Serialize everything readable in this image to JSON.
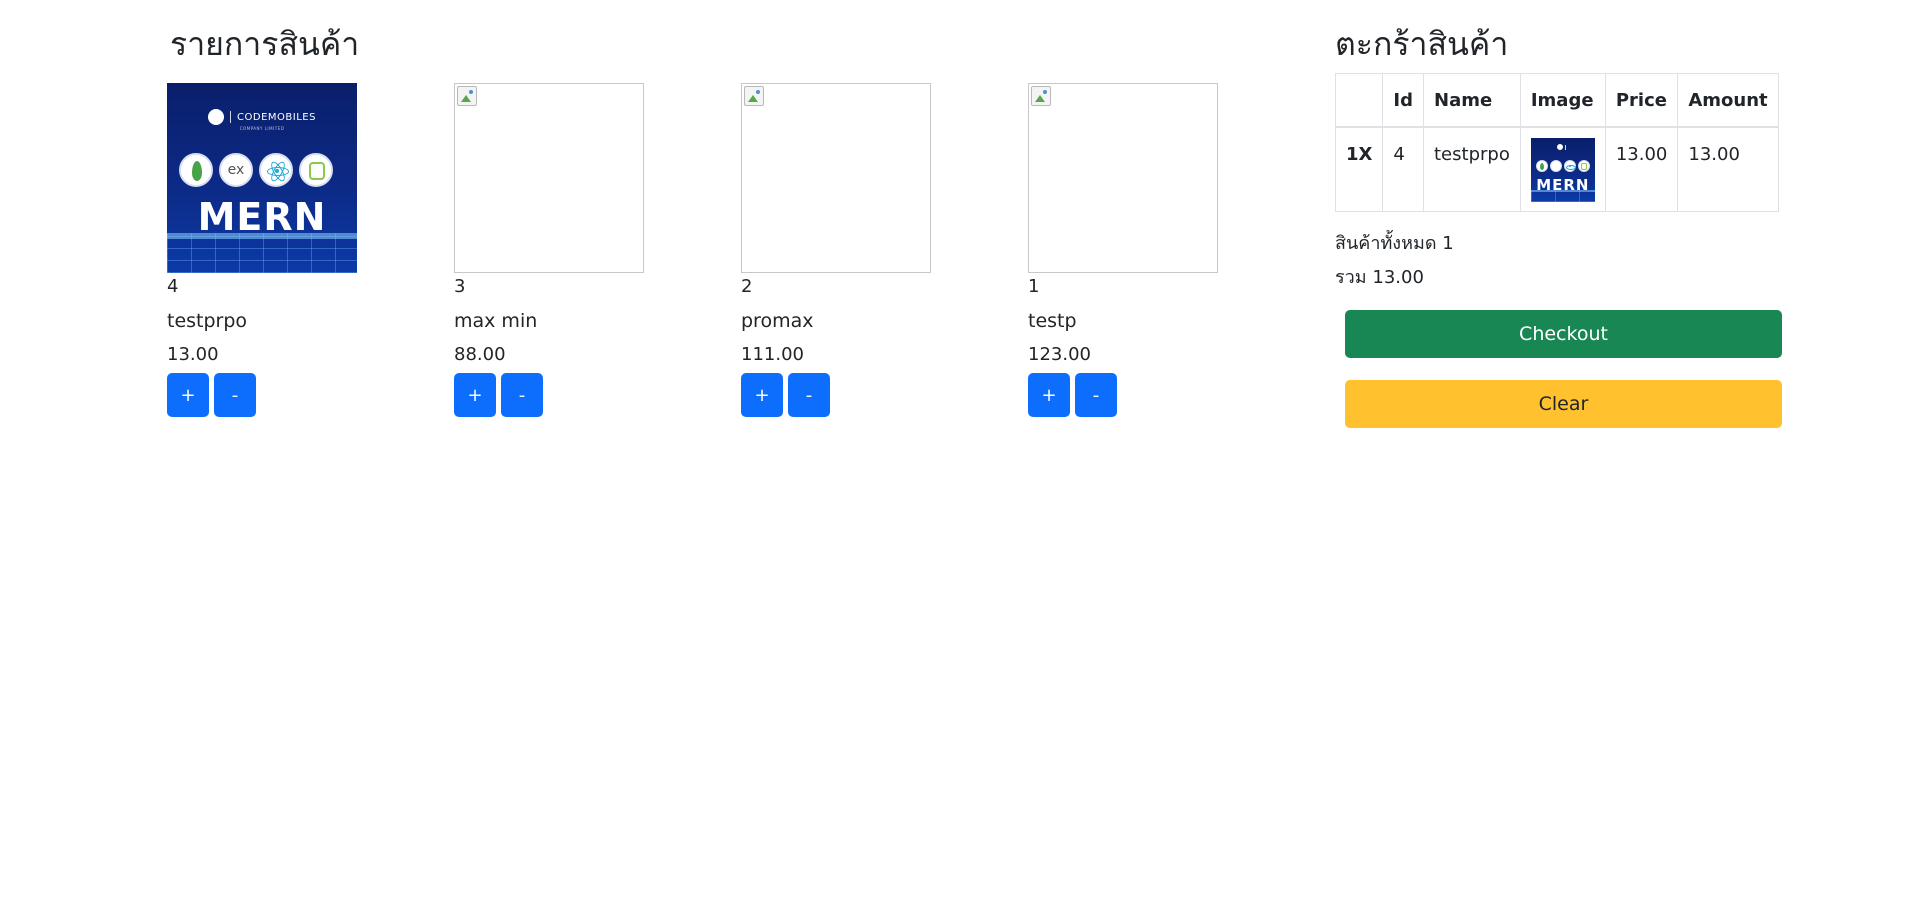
{
  "products_section": {
    "title": "รายการสินค้า",
    "items": [
      {
        "id": "4",
        "name": "testprpo",
        "price": "13.00",
        "plus_label": "+",
        "minus_label": "-",
        "image": "MERN"
      },
      {
        "id": "3",
        "name": "max min",
        "price": "88.00",
        "plus_label": "+",
        "minus_label": "-",
        "image": "broken"
      },
      {
        "id": "2",
        "name": "promax",
        "price": "111.00",
        "plus_label": "+",
        "minus_label": "-",
        "image": "broken"
      },
      {
        "id": "1",
        "name": "testp",
        "price": "123.00",
        "plus_label": "+",
        "minus_label": "-",
        "image": "broken"
      }
    ]
  },
  "poster": {
    "brand": "CODEMOBILES",
    "brand_sub": "COMPANY LIMITED",
    "express_label": "ex",
    "word": "MERN"
  },
  "cart": {
    "title": "ตะกร้าสินค้า",
    "columns": [
      "",
      "Id",
      "Name",
      "Image",
      "Price",
      "Amount"
    ],
    "rows": [
      {
        "qty": "1X",
        "id": "4",
        "name": "testprpo",
        "image": "MERN",
        "price": "13.00",
        "amount": "13.00"
      }
    ],
    "total_count_text": "สินค้าทั้งหมด 1",
    "total_sum_text": "รวม 13.00",
    "checkout_label": "Checkout",
    "clear_label": "Clear"
  },
  "colors": {
    "primary": "#0d6efd",
    "success": "#198754",
    "warning": "#ffc12e"
  }
}
